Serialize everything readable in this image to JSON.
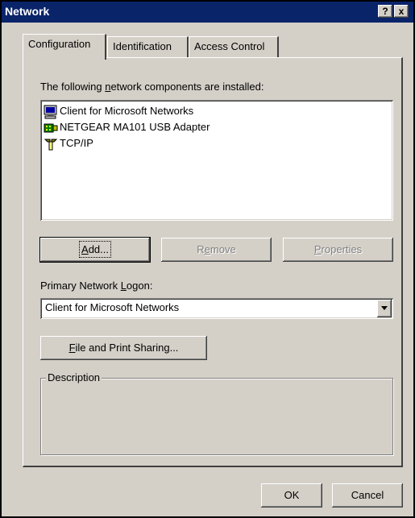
{
  "window": {
    "title": "Network",
    "help_label": "?",
    "close_label": "x"
  },
  "tabs": [
    {
      "label": "Configuration",
      "active": true
    },
    {
      "label": "Identification",
      "active": false
    },
    {
      "label": "Access Control",
      "active": false
    }
  ],
  "components": {
    "label_pre": "The following ",
    "label_key": "n",
    "label_post": "etwork components are installed:",
    "items": [
      {
        "label": "Client for Microsoft Networks",
        "icon": "network-client-icon"
      },
      {
        "label": "NETGEAR MA101 USB Adapter",
        "icon": "network-adapter-icon"
      },
      {
        "label": "TCP/IP",
        "icon": "protocol-icon"
      }
    ]
  },
  "buttons": {
    "add_key": "A",
    "add_rest": "dd...",
    "remove_pre": "R",
    "remove_key": "e",
    "remove_rest": "move",
    "properties_key": "P",
    "properties_rest": "roperties",
    "file_print_key": "F",
    "file_print_rest": "ile and Print Sharing...",
    "ok": "OK",
    "cancel": "Cancel"
  },
  "logon": {
    "label_pre": "Primary Network ",
    "label_key": "L",
    "label_post": "ogon:",
    "selected": "Client for Microsoft Networks"
  },
  "description": {
    "title": "Description",
    "text": ""
  },
  "colors": {
    "titlebar": "#0a246a",
    "face": "#d4d0c8",
    "disabled_text": "#808080"
  }
}
